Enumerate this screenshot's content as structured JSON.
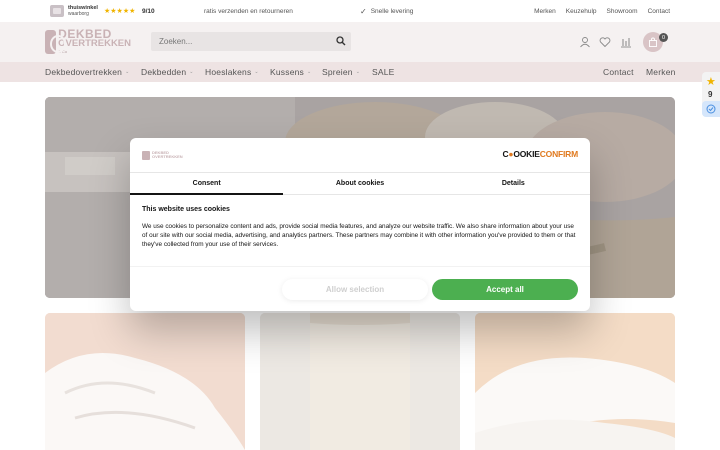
{
  "colors": {
    "brand": "#c9b2b5",
    "nav_bg": "#eee3e3",
    "header_bg": "#f5f1f1",
    "accept_green": "#4caf50",
    "cookieconfirm_orange": "#e07a1f"
  },
  "topbar": {
    "thuiswinkel_title": "thuiswinkel",
    "thuiswinkel_sub": "waarborg",
    "stars": "★★★★★",
    "rating": "9/10",
    "free_shipping": "ratis verzenden en retourneren",
    "fast_delivery": "Snelle levering",
    "links": [
      "Merken",
      "Keuzehulp",
      "Showroom",
      "Contact"
    ]
  },
  "header": {
    "logo_line1": "DEKBED",
    "logo_line2": "OVERTREKKEN",
    "logo_line3": "& Co",
    "search_placeholder": "Zoeken...",
    "cart_count": "0",
    "icons": [
      "user-icon",
      "heart-icon",
      "compare-icon",
      "bag-icon"
    ]
  },
  "nav": {
    "items": [
      {
        "label": "Dekbedovertrekken",
        "has_dropdown": true
      },
      {
        "label": "Dekbedden",
        "has_dropdown": true
      },
      {
        "label": "Hoeslakens",
        "has_dropdown": true
      },
      {
        "label": "Kussens",
        "has_dropdown": true
      },
      {
        "label": "Spreien",
        "has_dropdown": true
      },
      {
        "label": "SALE",
        "has_dropdown": false
      }
    ],
    "right": [
      "Contact",
      "Merken"
    ]
  },
  "side_widget": {
    "score": "9"
  },
  "cookie_dialog": {
    "brand_prefix": "C",
    "brand_middle": "OOKIE",
    "brand_suffix": "CONFIRM",
    "tabs": [
      "Consent",
      "About cookies",
      "Details"
    ],
    "active_tab": "Consent",
    "heading": "This website uses cookies",
    "body": "We use cookies to personalize content and ads, provide social media features, and analyze our website traffic. We also share information about your use of our site with our social media, advertising, and analytics partners. These partners may combine it with other information you've provided to them or that they've collected from your use of their services.",
    "allow_selection": "Allow selection",
    "accept_all": "Accept all"
  }
}
